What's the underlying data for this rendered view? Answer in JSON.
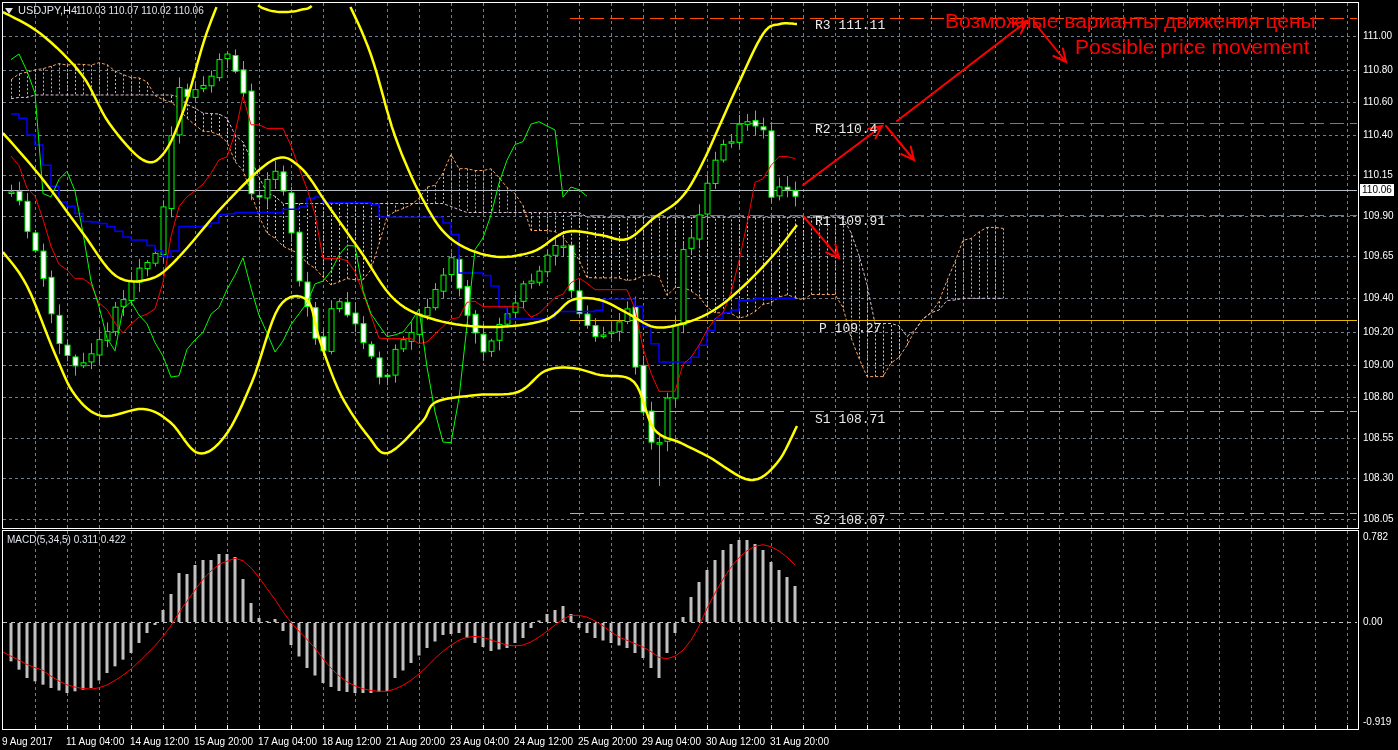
{
  "chart_header": {
    "symbol": "USDJPY,H4",
    "ohlc": "110.03 110.07 110.02 110.06"
  },
  "price_chart": {
    "pivot_levels": [
      {
        "kind": "resistance",
        "label": "R3 111.11"
      },
      {
        "kind": "resistance",
        "label": "R2 110.4"
      },
      {
        "kind": "resistance",
        "label": "R1 109.91"
      },
      {
        "kind": "pivot",
        "label": "P 109.27"
      },
      {
        "kind": "support",
        "label": "S1 108.71"
      },
      {
        "kind": "support",
        "label": "S2 108.07"
      }
    ],
    "annotation": [
      "Возможные варианты движения цены",
      "Possible price movement"
    ],
    "price_axis": [
      "111.00",
      "110.80",
      "110.60",
      "110.40",
      "110.15",
      "109.90",
      "109.65",
      "109.40",
      "109.20",
      "109.00",
      "108.80",
      "108.55",
      "108.30",
      "108.05"
    ],
    "current_price": "110.06"
  },
  "macd_panel": {
    "title": "MACD(5,34,5) 0.311 0.422",
    "axis": [
      "0.782",
      "0.00",
      "-0.919"
    ]
  },
  "time_axis": [
    "9 Aug 2017",
    "11 Aug 04:00",
    "14 Aug 12:00",
    "15 Aug 20:00",
    "17 Aug 04:00",
    "18 Aug 12:00",
    "21 Aug 20:00",
    "23 Aug 04:00",
    "24 Aug 12:00",
    "25 Aug 20:00",
    "29 Aug 04:00",
    "30 Aug 12:00",
    "31 Aug 20:00"
  ]
}
